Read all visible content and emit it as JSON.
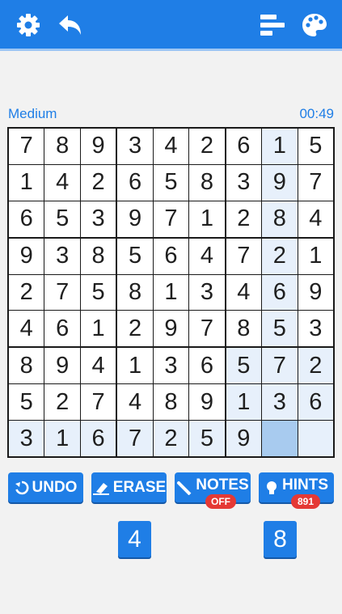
{
  "header": {
    "settings_icon": "gear-icon",
    "back_icon": "undo-arrow-icon",
    "stats_icon": "bars-icon",
    "theme_icon": "palette-icon"
  },
  "game": {
    "difficulty": "Medium",
    "timer": "00:49"
  },
  "board": {
    "rows": [
      [
        "7",
        "8",
        "9",
        "3",
        "4",
        "2",
        "6",
        "1",
        "5"
      ],
      [
        "1",
        "4",
        "2",
        "6",
        "5",
        "8",
        "3",
        "9",
        "7"
      ],
      [
        "6",
        "5",
        "3",
        "9",
        "7",
        "1",
        "2",
        "8",
        "4"
      ],
      [
        "9",
        "3",
        "8",
        "5",
        "6",
        "4",
        "7",
        "2",
        "1"
      ],
      [
        "2",
        "7",
        "5",
        "8",
        "1",
        "3",
        "4",
        "6",
        "9"
      ],
      [
        "4",
        "6",
        "1",
        "2",
        "9",
        "7",
        "8",
        "5",
        "3"
      ],
      [
        "8",
        "9",
        "4",
        "1",
        "3",
        "6",
        "5",
        "7",
        "2"
      ],
      [
        "5",
        "2",
        "7",
        "4",
        "8",
        "9",
        "1",
        "3",
        "6"
      ],
      [
        "3",
        "1",
        "6",
        "7",
        "2",
        "5",
        "9",
        "",
        ""
      ]
    ],
    "selected": {
      "row": 8,
      "col": 7
    },
    "colors": {
      "selected": "#a8cbef",
      "highlight": "#e7f0fb",
      "accent": "#1f7ee6"
    }
  },
  "actions": {
    "undo": "UNDO",
    "erase": "ERASE",
    "notes": "NOTES",
    "notes_state": "OFF",
    "hints": "HINTS",
    "hints_count": "891"
  },
  "remaining_numbers": [
    "4",
    "8"
  ]
}
